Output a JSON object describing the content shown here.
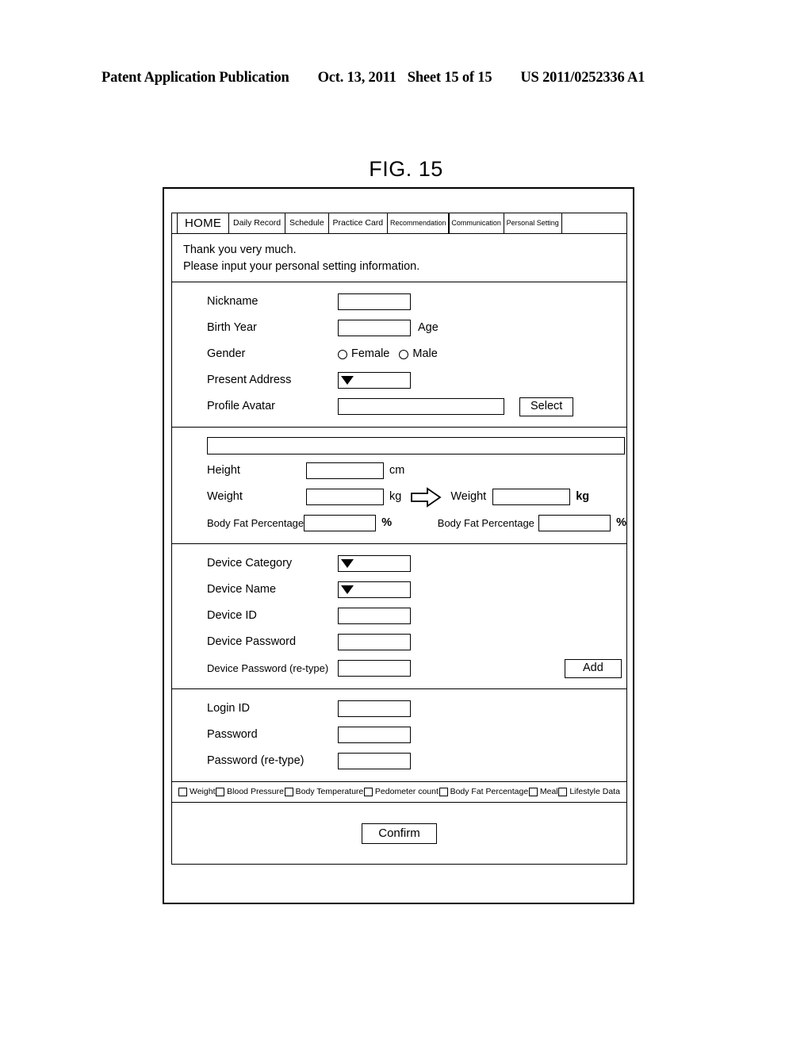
{
  "publication": {
    "title": "Patent Application Publication",
    "date": "Oct. 13, 2011",
    "sheet": "Sheet 15 of 15",
    "number": "US 2011/0252336 A1"
  },
  "figure": {
    "caption": "FIG. 15"
  },
  "tabs": [
    {
      "label": "HOME",
      "active": true
    },
    {
      "label": "Daily Record",
      "active": false
    },
    {
      "label": "Schedule",
      "active": false
    },
    {
      "label": "Practice Card",
      "active": false
    },
    {
      "label": "Recommendation",
      "active": false
    },
    {
      "label": "Communication",
      "active": false
    },
    {
      "label": "Personal Setting",
      "active": false
    }
  ],
  "message": {
    "line1": "Thank you very much.",
    "line2": "Please input your personal setting information."
  },
  "profile_section": {
    "nickname_label": "Nickname",
    "nickname_value": "",
    "birth_year_label": "Birth Year",
    "birth_year_value": "",
    "age_label": "Age",
    "gender_label": "Gender",
    "gender_options": [
      {
        "label": "Female",
        "selected": false
      },
      {
        "label": "Male",
        "selected": false
      }
    ],
    "present_address_label": "Present Address",
    "present_address_value": "",
    "profile_avatar_label": "Profile Avatar",
    "profile_avatar_value": "",
    "select_button": "Select"
  },
  "body_section": {
    "top_bar_value": "",
    "height_label": "Height",
    "height_value": "",
    "height_unit": "cm",
    "weight_label": "Weight",
    "weight_value": "",
    "weight_unit": "kg",
    "body_fat_label": "Body Fat Percentage",
    "body_fat_value": "",
    "body_fat_unit": "%",
    "arrow": "right-arrow-icon",
    "target_weight_label": "Weight",
    "target_weight_value": "",
    "target_weight_unit": "kg",
    "target_body_fat_label": "Body Fat Percentage",
    "target_body_fat_value": "",
    "target_body_fat_unit": "%"
  },
  "device_section": {
    "device_category_label": "Device Category",
    "device_category_value": "",
    "device_name_label": "Device Name",
    "device_name_value": "",
    "device_id_label": "Device ID",
    "device_id_value": "",
    "device_password_label": "Device Password",
    "device_password_value": "",
    "device_password_retype_label": "Device Password (re-type)",
    "device_password_retype_value": "",
    "add_button": "Add"
  },
  "login_section": {
    "login_id_label": "Login ID",
    "login_id_value": "",
    "password_label": "Password",
    "password_value": "",
    "password_retype_label": "Password (re-type)",
    "password_retype_value": ""
  },
  "data_types": [
    {
      "label": "Weight",
      "checked": false
    },
    {
      "label": "Blood Pressure",
      "checked": false
    },
    {
      "label": "Body Temperature",
      "checked": false
    },
    {
      "label": "Pedometer count",
      "checked": false
    },
    {
      "label": "Body Fat Percentage",
      "checked": false
    },
    {
      "label": "Meal",
      "checked": false
    },
    {
      "label": "Lifestyle Data",
      "checked": false
    }
  ],
  "footer": {
    "confirm_button": "Confirm"
  }
}
